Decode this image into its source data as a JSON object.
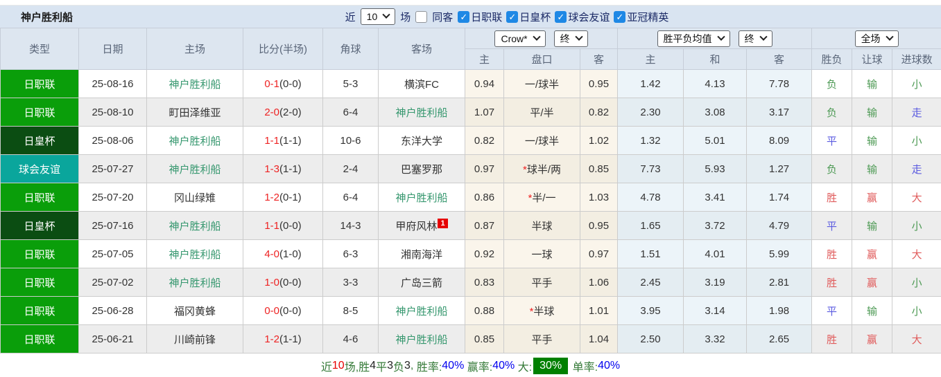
{
  "toolbar": {
    "title": "神户胜利船",
    "near_label": "近",
    "games_count": "10",
    "games_label": "场",
    "same_opponent_label": "同客",
    "filters": [
      {
        "label": "日职联",
        "checked": true
      },
      {
        "label": "日皇杯",
        "checked": true
      },
      {
        "label": "球会友谊",
        "checked": true
      },
      {
        "label": "亚冠精英",
        "checked": true
      }
    ]
  },
  "table": {
    "headers": {
      "type": "类型",
      "date": "日期",
      "home": "主场",
      "score": "比分(半场)",
      "corners": "角球",
      "away": "客场"
    },
    "selects": {
      "bookmaker": "Crow*",
      "bookmaker_time": "终",
      "europe": "胜平负均值",
      "europe_time": "终",
      "scope": "全场"
    },
    "subheaders": [
      "主",
      "盘口",
      "客",
      "主",
      "和",
      "客",
      "胜负",
      "让球",
      "进球数"
    ],
    "rows": [
      {
        "type": "日职联",
        "type_class": "jl",
        "date": "25-08-16",
        "home": "神户胜利船",
        "home_self": true,
        "ft": "0-1",
        "ht": "(0-0)",
        "corners": "5-3",
        "away": "横滨FC",
        "away_self": false,
        "away_badge": "",
        "asian": {
          "home": "0.94",
          "star": false,
          "line": "一/球半",
          "away": "0.95"
        },
        "euro": [
          "1.42",
          "4.13",
          "7.78"
        ],
        "results": [
          [
            "负",
            "g"
          ],
          [
            "输",
            "g"
          ],
          [
            "小",
            "g"
          ]
        ]
      },
      {
        "type": "日职联",
        "type_class": "jl",
        "date": "25-08-10",
        "home": "町田泽维亚",
        "home_self": false,
        "ft": "2-0",
        "ht": "(2-0)",
        "corners": "6-4",
        "away": "神户胜利船",
        "away_self": true,
        "away_badge": "",
        "asian": {
          "home": "1.07",
          "star": false,
          "line": "平/半",
          "away": "0.82"
        },
        "euro": [
          "2.30",
          "3.08",
          "3.17"
        ],
        "results": [
          [
            "负",
            "g"
          ],
          [
            "输",
            "g"
          ],
          [
            "走",
            "b"
          ]
        ]
      },
      {
        "type": "日皇杯",
        "type_class": "ek",
        "date": "25-08-06",
        "home": "神户胜利船",
        "home_self": true,
        "ft": "1-1",
        "ht": "(1-1)",
        "corners": "10-6",
        "away": "东洋大学",
        "away_self": false,
        "away_badge": "",
        "asian": {
          "home": "0.82",
          "star": false,
          "line": "一/球半",
          "away": "1.02"
        },
        "euro": [
          "1.32",
          "5.01",
          "8.09"
        ],
        "results": [
          [
            "平",
            "b"
          ],
          [
            "输",
            "g"
          ],
          [
            "小",
            "g"
          ]
        ]
      },
      {
        "type": "球会友谊",
        "type_class": "fr",
        "date": "25-07-27",
        "home": "神户胜利船",
        "home_self": true,
        "ft": "1-3",
        "ht": "(1-1)",
        "corners": "2-4",
        "away": "巴塞罗那",
        "away_self": false,
        "away_badge": "",
        "asian": {
          "home": "0.97",
          "star": true,
          "line": "球半/两",
          "away": "0.85"
        },
        "euro": [
          "7.73",
          "5.93",
          "1.27"
        ],
        "results": [
          [
            "负",
            "g"
          ],
          [
            "输",
            "g"
          ],
          [
            "走",
            "b"
          ]
        ]
      },
      {
        "type": "日职联",
        "type_class": "jl",
        "date": "25-07-20",
        "home": "冈山绿雉",
        "home_self": false,
        "ft": "1-2",
        "ht": "(0-1)",
        "corners": "6-4",
        "away": "神户胜利船",
        "away_self": true,
        "away_badge": "",
        "asian": {
          "home": "0.86",
          "star": true,
          "line": "半/一",
          "away": "1.03"
        },
        "euro": [
          "4.78",
          "3.41",
          "1.74"
        ],
        "results": [
          [
            "胜",
            "r"
          ],
          [
            "赢",
            "r"
          ],
          [
            "大",
            "r"
          ]
        ]
      },
      {
        "type": "日皇杯",
        "type_class": "ek",
        "date": "25-07-16",
        "home": "神户胜利船",
        "home_self": true,
        "ft": "1-1",
        "ht": "(0-0)",
        "corners": "14-3",
        "away": "甲府风林",
        "away_self": false,
        "away_badge": "1",
        "asian": {
          "home": "0.87",
          "star": false,
          "line": "半球",
          "away": "0.95"
        },
        "euro": [
          "1.65",
          "3.72",
          "4.79"
        ],
        "results": [
          [
            "平",
            "b"
          ],
          [
            "输",
            "g"
          ],
          [
            "小",
            "g"
          ]
        ]
      },
      {
        "type": "日职联",
        "type_class": "jl",
        "date": "25-07-05",
        "home": "神户胜利船",
        "home_self": true,
        "ft": "4-0",
        "ht": "(1-0)",
        "corners": "6-3",
        "away": "湘南海洋",
        "away_self": false,
        "away_badge": "",
        "asian": {
          "home": "0.92",
          "star": false,
          "line": "一球",
          "away": "0.97"
        },
        "euro": [
          "1.51",
          "4.01",
          "5.99"
        ],
        "results": [
          [
            "胜",
            "r"
          ],
          [
            "赢",
            "r"
          ],
          [
            "大",
            "r"
          ]
        ]
      },
      {
        "type": "日职联",
        "type_class": "jl",
        "date": "25-07-02",
        "home": "神户胜利船",
        "home_self": true,
        "ft": "1-0",
        "ht": "(0-0)",
        "corners": "3-3",
        "away": "广岛三箭",
        "away_self": false,
        "away_badge": "",
        "asian": {
          "home": "0.83",
          "star": false,
          "line": "平手",
          "away": "1.06"
        },
        "euro": [
          "2.45",
          "3.19",
          "2.81"
        ],
        "results": [
          [
            "胜",
            "r"
          ],
          [
            "赢",
            "r"
          ],
          [
            "小",
            "g"
          ]
        ]
      },
      {
        "type": "日职联",
        "type_class": "jl",
        "date": "25-06-28",
        "home": "福冈黄蜂",
        "home_self": false,
        "ft": "0-0",
        "ht": "(0-0)",
        "corners": "8-5",
        "away": "神户胜利船",
        "away_self": true,
        "away_badge": "",
        "asian": {
          "home": "0.88",
          "star": true,
          "line": "半球",
          "away": "1.01"
        },
        "euro": [
          "3.95",
          "3.14",
          "1.98"
        ],
        "results": [
          [
            "平",
            "b"
          ],
          [
            "输",
            "g"
          ],
          [
            "小",
            "g"
          ]
        ]
      },
      {
        "type": "日职联",
        "type_class": "jl",
        "date": "25-06-21",
        "home": "川崎前锋",
        "home_self": false,
        "ft": "1-2",
        "ht": "(1-1)",
        "corners": "4-6",
        "away": "神户胜利船",
        "away_self": true,
        "away_badge": "",
        "asian": {
          "home": "0.85",
          "star": false,
          "line": "平手",
          "away": "1.04"
        },
        "euro": [
          "2.50",
          "3.32",
          "2.65"
        ],
        "results": [
          [
            "胜",
            "r"
          ],
          [
            "赢",
            "r"
          ],
          [
            "大",
            "r"
          ]
        ]
      }
    ]
  },
  "footer": {
    "segments": [
      {
        "text": "近",
        "style": "green"
      },
      {
        "text": "10",
        "style": "red"
      },
      {
        "text": "场,",
        "style": "green"
      },
      {
        "text": "胜",
        "style": "green"
      },
      {
        "text": "4",
        "style": "dark"
      },
      {
        "text": "平",
        "style": "green"
      },
      {
        "text": "3",
        "style": "dark"
      },
      {
        "text": "负",
        "style": "green"
      },
      {
        "text": "3",
        "style": "dark"
      },
      {
        "text": ", ",
        "style": "green"
      },
      {
        "text": "胜率:",
        "style": "green"
      },
      {
        "text": "40%",
        "style": "blue"
      },
      {
        "text": " 赢率:",
        "style": "green"
      },
      {
        "text": "40%",
        "style": "blue"
      },
      {
        "text": " 大:",
        "style": "green"
      },
      {
        "text": "30%",
        "style": "badge30"
      },
      {
        "text": " 单率:",
        "style": "green"
      },
      {
        "text": "40%",
        "style": "blue"
      }
    ]
  },
  "colors": {
    "league_jl": "#0a9e0a",
    "league_emperor": "#0b4d12",
    "league_friendly": "#0aa69c",
    "kobe_team": "#35976e",
    "score_red": "#ee2222",
    "result_win_red": "#e05b5b",
    "result_draw_blue": "#5a5ae0",
    "result_lose_green": "#4e9a55",
    "asian_bg": "#faf5eb",
    "euro_bg": "#ecf4f9",
    "toolbar_bg": "#d9e4f1",
    "checkbox_blue": "#1e88e5",
    "badge_green": "#008000"
  }
}
